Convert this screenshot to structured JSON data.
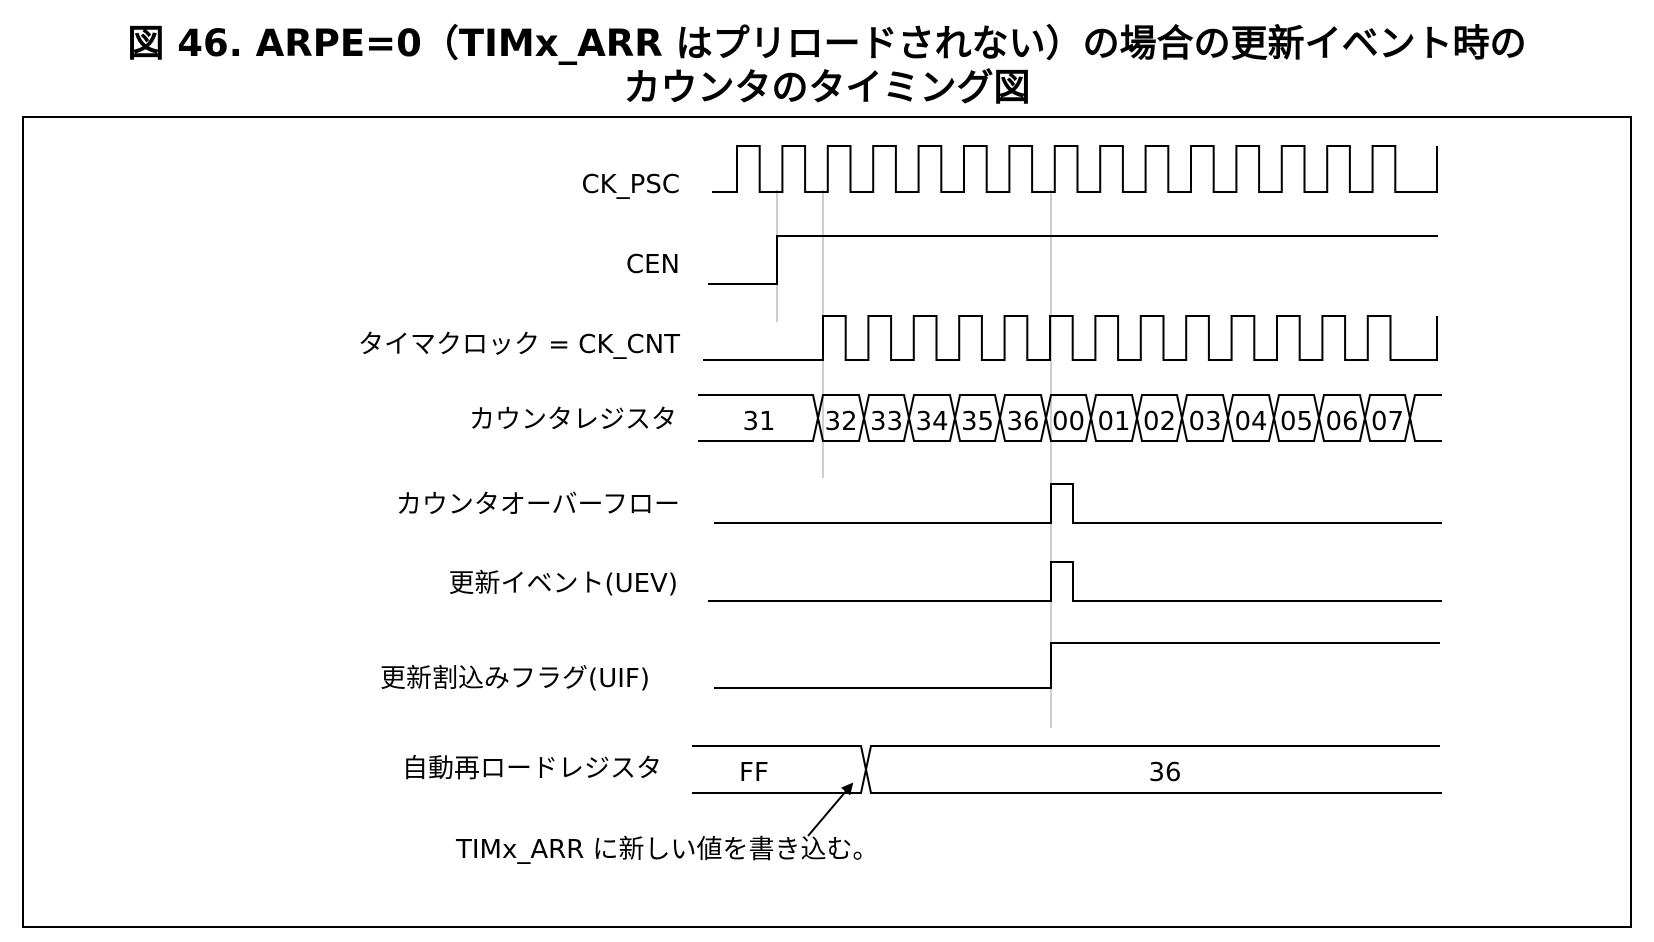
{
  "title": {
    "line1": "図 46. ARPE=0（TIMx_ARR はプリロードされない）の場合の更新イベント時の",
    "line2": "カウンタのタイミング図"
  },
  "signals": {
    "ck_psc": "CK_PSC",
    "cen": "CEN",
    "ck_cnt": "タイマクロック = CK_CNT",
    "counter": "カウンタレジスタ",
    "overflow": "カウンタオーバーフロー",
    "uev": "更新イベント(UEV)",
    "uif": "更新割込みフラグ(UIF)",
    "arr": "自動再ロードレジスタ"
  },
  "counter_values": [
    "31",
    "32",
    "33",
    "34",
    "35",
    "36",
    "00",
    "01",
    "02",
    "03",
    "04",
    "05",
    "06",
    "07"
  ],
  "arr_values": [
    "FF",
    "36"
  ],
  "annotation": "TIMx_ARR に新しい値を書き込む。"
}
